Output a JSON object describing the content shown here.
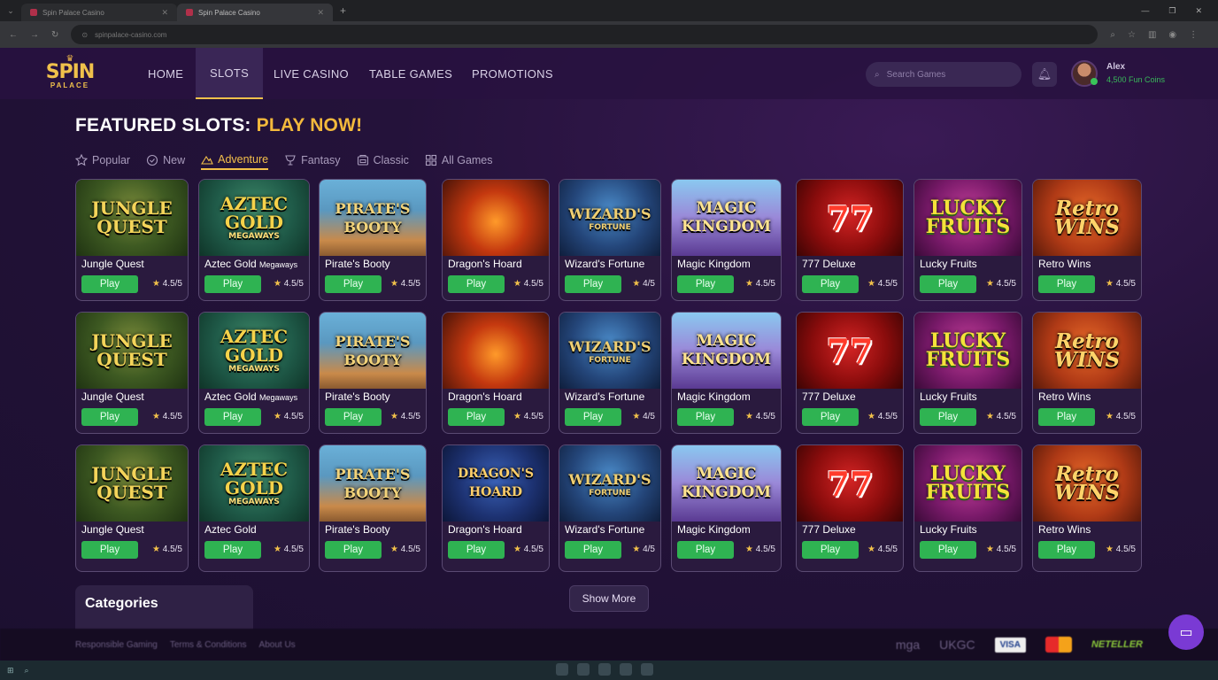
{
  "browser": {
    "tabs": [
      {
        "label": "Spin Palace Casino"
      },
      {
        "label": "Spin Palace Casino"
      }
    ],
    "url": "spinpalace-casino.com"
  },
  "site": {
    "logo": {
      "line1": "SPIN",
      "line2": "PALACE"
    },
    "nav": [
      "HOME",
      "SLOTS",
      "LIVE CASINO",
      "TABLE GAMES",
      "PROMOTIONS"
    ],
    "search_placeholder": "Search Games",
    "user": {
      "name": "Alex",
      "coins": "4,500 Fun Coins"
    }
  },
  "heading": {
    "main": "FEATURED SLOTS:",
    "accent": "PLAY NOW!"
  },
  "filters": [
    {
      "label": "Popular",
      "icon": "star-icon"
    },
    {
      "label": "New",
      "icon": "clock-icon"
    },
    {
      "label": "Adventure",
      "icon": "mountain-icon"
    },
    {
      "label": "Fantasy",
      "icon": "goblet-icon"
    },
    {
      "label": "Classic",
      "icon": "slot-machine-icon"
    },
    {
      "label": "All Games",
      "icon": "grid-icon"
    }
  ],
  "play_label": "Play",
  "games": [
    {
      "row": [
        {
          "name": "Jungle Quest",
          "art": [
            "JUNGLE",
            "QUEST"
          ],
          "theme": "jungle",
          "rating": "4.5/5"
        },
        {
          "name": "Aztec Gold",
          "suffix": "Megaways",
          "art": [
            "AZTEC",
            "GOLD"
          ],
          "art_sub": "MEGAWAYS",
          "theme": "aztec",
          "rating": "4.5/5"
        },
        {
          "name": "Pirate's Booty",
          "art": [
            "PIRATE'S",
            "BOOTY"
          ],
          "theme": "pirate",
          "rating": "4.5/5"
        },
        {
          "name": "Dragon's Hoard",
          "art": [],
          "theme": "dragon",
          "rating": "4.5/5"
        },
        {
          "name": "Wizard's Fortune",
          "art": [
            "WIZARD'S"
          ],
          "art_sub": "FORTUNE",
          "theme": "wizard",
          "rating": "4/5"
        },
        {
          "name": "Magic Kingdom",
          "art": [
            "MAGIC",
            "KINGDOM"
          ],
          "theme": "magic",
          "rating": "4.5/5"
        },
        {
          "name": "777 Deluxe",
          "art": [
            "77"
          ],
          "theme": "sevens",
          "rating": "4.5/5"
        },
        {
          "name": "Lucky Fruits",
          "art": [
            "LUCKY",
            "FRUITS"
          ],
          "theme": "lucky",
          "rating": "4.5/5"
        },
        {
          "name": "Retro Wins",
          "art": [
            "Retro",
            "WINS"
          ],
          "theme": "retro",
          "rating": "4.5/5"
        }
      ]
    },
    {
      "row": [
        {
          "name": "Jungle Quest",
          "art": [
            "JUNGLE",
            "QUEST"
          ],
          "theme": "jungle",
          "rating": "4.5/5"
        },
        {
          "name": "Aztec Gold",
          "suffix": "Megaways",
          "art": [
            "AZTEC",
            "GOLD"
          ],
          "art_sub": "MEGAWAYS",
          "theme": "aztec",
          "rating": "4.5/5"
        },
        {
          "name": "Pirate's Booty",
          "art": [
            "PIRATE'S",
            "BOOTY"
          ],
          "theme": "pirate",
          "rating": "4.5/5"
        },
        {
          "name": "Dragon's Hoard",
          "art": [],
          "theme": "dragon",
          "rating": "4.5/5"
        },
        {
          "name": "Wizard's Fortune",
          "art": [
            "WIZARD'S"
          ],
          "art_sub": "FORTUNE",
          "theme": "wizard",
          "rating": "4/5"
        },
        {
          "name": "Magic Kingdom",
          "art": [
            "MAGIC",
            "KINGDOM"
          ],
          "theme": "magic",
          "rating": "4.5/5"
        },
        {
          "name": "777 Deluxe",
          "art": [
            "77"
          ],
          "theme": "sevens",
          "rating": "4.5/5"
        },
        {
          "name": "Lucky Fruits",
          "art": [
            "LUCKY",
            "FRUITS"
          ],
          "theme": "lucky",
          "rating": "4.5/5"
        },
        {
          "name": "Retro Wins",
          "art": [
            "Retro",
            "WINS"
          ],
          "theme": "retro",
          "rating": "4.5/5"
        }
      ]
    },
    {
      "row": [
        {
          "name": "Jungle Quest",
          "art": [
            "JUNGLE",
            "QUEST"
          ],
          "theme": "jungle",
          "rating": "4.5/5"
        },
        {
          "name": "Aztec Gold",
          "art": [
            "AZTEC",
            "GOLD"
          ],
          "art_sub": "MEGAWAYS",
          "theme": "aztec",
          "rating": "4.5/5"
        },
        {
          "name": "Pirate's Booty",
          "art": [
            "PIRATE'S",
            "BOOTY"
          ],
          "theme": "pirate",
          "rating": "4.5/5"
        },
        {
          "name": "Dragon's Hoard",
          "art": [
            "DRAGON'S",
            "HOARD"
          ],
          "theme": "dragon2",
          "rating": "4.5/5"
        },
        {
          "name": "Wizard's Fortune",
          "art": [
            "WIZARD'S"
          ],
          "art_sub": "FORTUNE",
          "theme": "wizard",
          "rating": "4/5"
        },
        {
          "name": "Magic Kingdom",
          "art": [
            "MAGIC",
            "KINGDOM"
          ],
          "theme": "magic",
          "rating": "4.5/5"
        },
        {
          "name": "777 Deluxe",
          "art": [
            "77"
          ],
          "theme": "sevens",
          "rating": "4.5/5"
        },
        {
          "name": "Lucky Fruits",
          "art": [
            "LUCKY",
            "FRUITS"
          ],
          "theme": "lucky",
          "rating": "4.5/5"
        },
        {
          "name": "Retro Wins",
          "art": [
            "Retro",
            "WINS"
          ],
          "theme": "retro",
          "rating": "4.5/5"
        }
      ]
    }
  ],
  "show_more": "Show More",
  "categories_title": "Categories",
  "footer": {
    "links": [
      "Responsible Gaming",
      "Terms & Conditions",
      "About Us"
    ],
    "logos": [
      "mga",
      "UKGC",
      "VISA",
      "NETELLER"
    ]
  },
  "colors": {
    "accent": "#f3b93c",
    "play_button": "#2fb352",
    "background": "#24123a"
  }
}
